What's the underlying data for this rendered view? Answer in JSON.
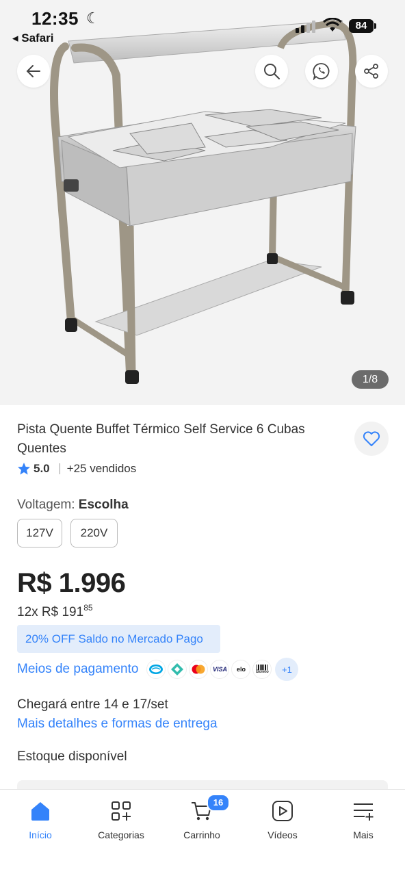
{
  "status_bar": {
    "time": "12:35",
    "back_app": "◂ Safari",
    "battery": "84"
  },
  "image_counter": "1/8",
  "product": {
    "title": "Pista Quente Buffet Térmico Self Service  6 Cubas Quentes",
    "rating": "5.0",
    "sold": "+25 vendidos",
    "rating_value": 5.0
  },
  "voltage": {
    "label": "Voltagem:",
    "selected": "Escolha",
    "options": [
      "127V",
      "220V"
    ]
  },
  "price": {
    "main": "R$ 1.996",
    "installments_prefix": "12x R$ 191",
    "installments_cents": "85",
    "promo": "20% OFF Saldo no Mercado Pago"
  },
  "payments": {
    "link": "Meios de pagamento",
    "methods": [
      "mercado-pago-icon",
      "pix-icon",
      "mastercard-icon",
      "visa-icon",
      "elo-icon",
      "boleto-icon"
    ],
    "visa_text": "VISA",
    "elo_text": "elo",
    "boleto_text": "Boleto",
    "more": "+1"
  },
  "delivery": {
    "text": "Chegará entre 14 e 17/set",
    "link": "Mais detalhes e formas de entrega"
  },
  "stock": "Estoque disponível",
  "tabs": [
    {
      "label": "Início",
      "icon": "home-icon",
      "active": true
    },
    {
      "label": "Categorias",
      "icon": "categories-icon",
      "active": false
    },
    {
      "label": "Carrinho",
      "icon": "cart-icon",
      "active": false,
      "badge": "16"
    },
    {
      "label": "Vídeos",
      "icon": "videos-icon",
      "active": false
    },
    {
      "label": "Mais",
      "icon": "more-icon",
      "active": false
    }
  ],
  "colors": {
    "accent": "#3483fa",
    "promo_bg": "#e3edfb",
    "frame": "#9e9686",
    "steel": "#c8c8c8"
  }
}
